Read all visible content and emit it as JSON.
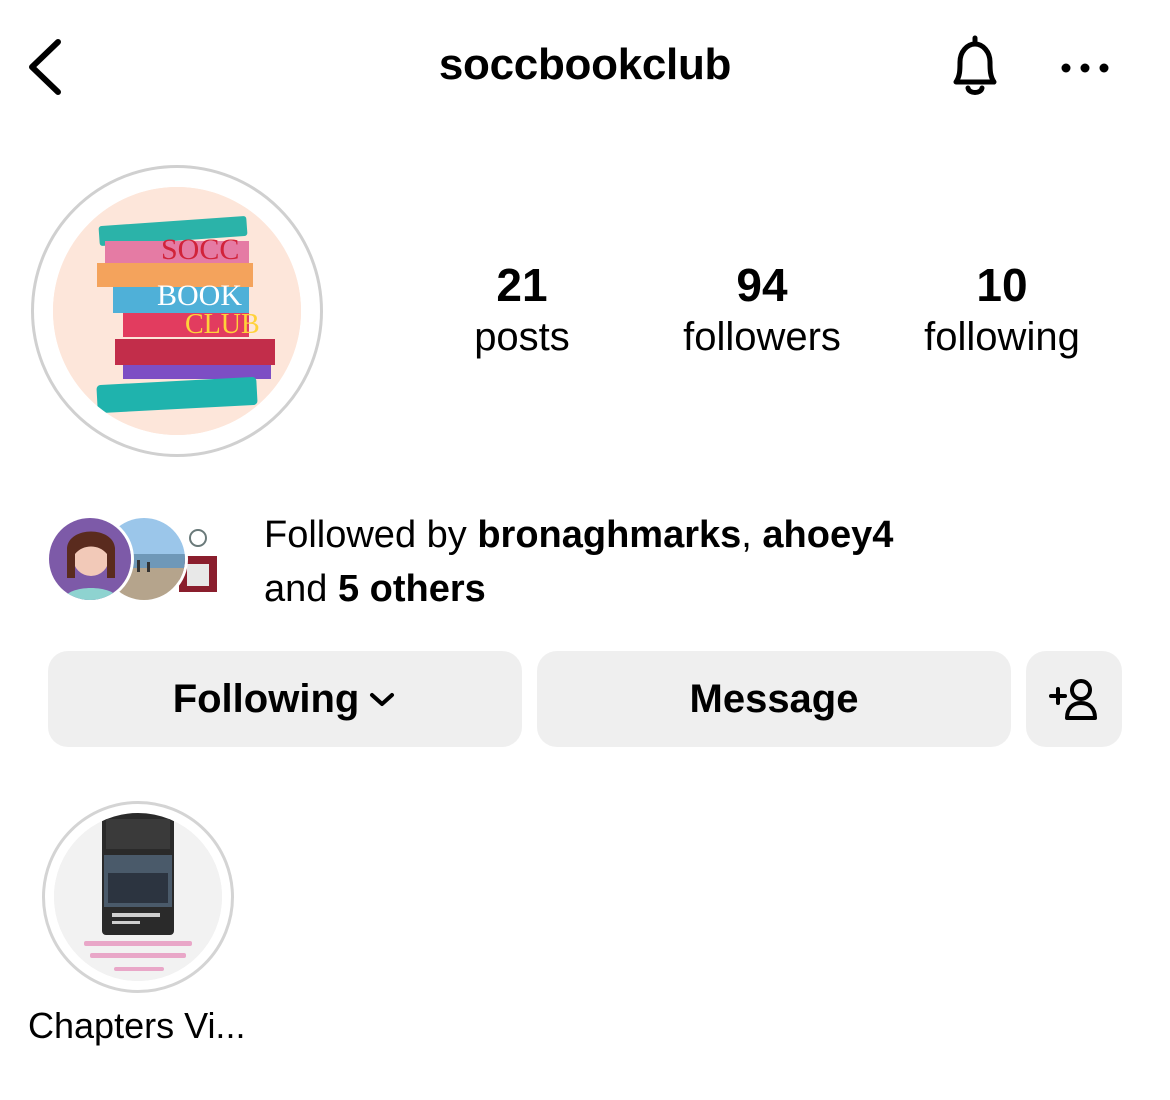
{
  "header": {
    "back_icon": "chevron-left-icon",
    "title": "soccbookclub",
    "bell_icon": "bell-icon",
    "more_icon": "more-horizontal-icon"
  },
  "profile": {
    "avatar_text": {
      "line1": "SOCC",
      "line2": "BOOK",
      "line3": "CLUB"
    }
  },
  "stats": [
    {
      "value": "21",
      "label": "posts"
    },
    {
      "value": "94",
      "label": "followers"
    },
    {
      "value": "10",
      "label": "following"
    }
  ],
  "followed_by": {
    "prefix": "Followed by ",
    "user1": "bronaghmarks",
    "sep": ", ",
    "user2": "ahoey4",
    "and": "and ",
    "others": "5 others"
  },
  "actions": {
    "following_label": "Following",
    "message_label": "Message",
    "add_user_icon": "add-user-icon"
  },
  "highlights": [
    {
      "label": "Chapters Vi..."
    }
  ],
  "colors": {
    "button_bg": "#efefef",
    "text": "#000000",
    "ring": "#d0d0d0"
  }
}
